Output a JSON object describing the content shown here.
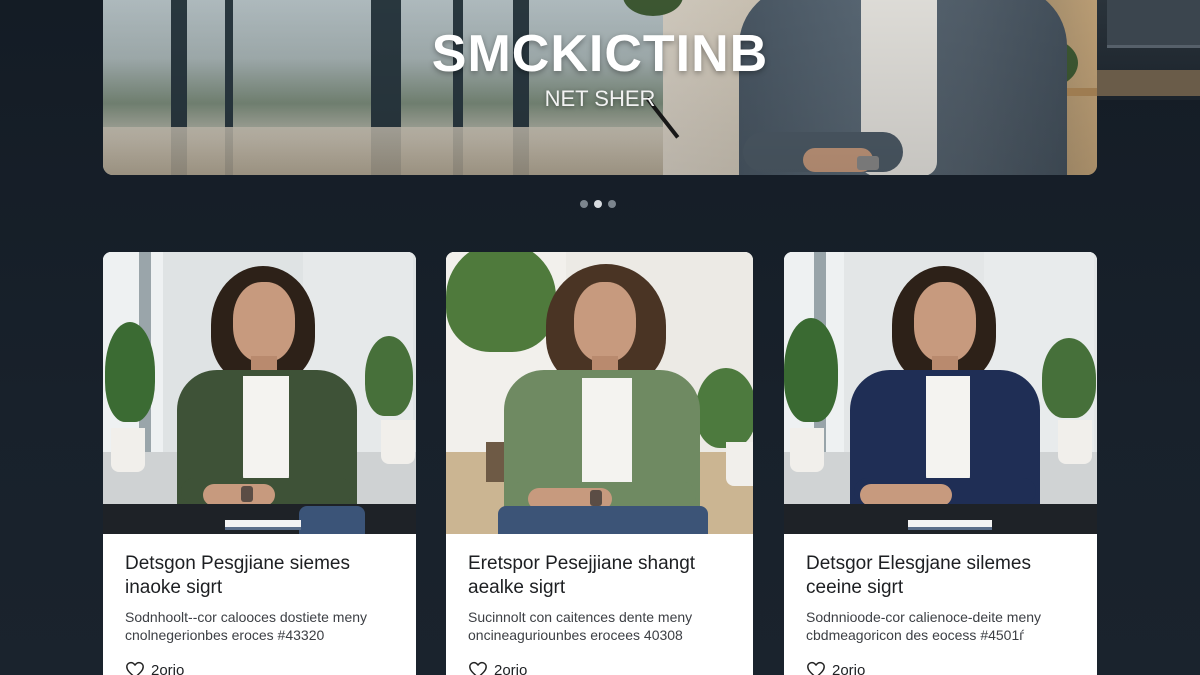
{
  "hero": {
    "title": "SMCKICTINB",
    "subtitle": "NET SHER"
  },
  "carousel": {
    "slide_count": 3,
    "active_index": 1
  },
  "cards": [
    {
      "title": "Detsgon Pesgjiane siemes inaoke sigrt",
      "description": "Sodnhoolt--cor calooces dostiete meny cnolnegerionbes eroces #43320",
      "likes": "2orio",
      "jacket_color": "#3e5237"
    },
    {
      "title": "Eretspor Pesejjiane shangt aealke sigrt",
      "description": "Sucinnolt con caitences dente meny oncineaguriounbes erocees 40308",
      "likes": "2orio",
      "jacket_color": "#6f8a62"
    },
    {
      "title": "Detsgor Elesgjane silemes ceeine sigrt",
      "description": "Sodnnioode-cor calienoce-deite meny cbdmeagoricon des eocess #4501ѓ",
      "likes": "2orio",
      "jacket_color": "#1f2e55"
    }
  ],
  "icons": {
    "like": "heart-icon"
  }
}
